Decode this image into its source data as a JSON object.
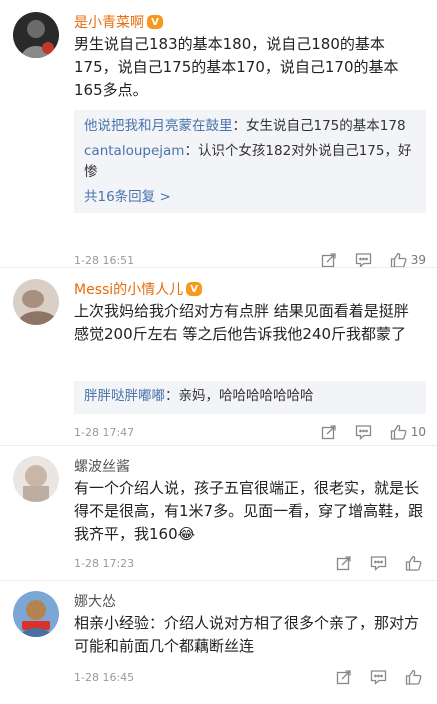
{
  "comments": [
    {
      "username": "是小青菜啊",
      "vip": "V",
      "text": "男生说自己183的基本180，说自己180的基本175，说自己175的基本170，说自己170的基本165多点。",
      "replies": [
        {
          "name": "他说把我和月亮蒙在鼓里",
          "sep": "：",
          "text": "女生说自己175的基本178"
        },
        {
          "name": "cantaloupejam",
          "sep": "：",
          "text": "认识个女孩182对外说自己175，好惨"
        }
      ],
      "more_replies": "共16条回复 >",
      "time": "1-28 16:51",
      "likes": "39"
    },
    {
      "username": "Messi的小情人儿",
      "vip": "V",
      "text": "上次我妈给我介绍对方有点胖 结果见面看着是挺胖 感觉200斤左右  等之后他告诉我他240斤我都蒙了",
      "replies": [
        {
          "name": "胖胖哒胖嘟嘟",
          "sep": "：",
          "text": "亲妈，哈哈哈哈哈哈哈"
        }
      ],
      "time": "1-28 17:47",
      "likes": "10"
    },
    {
      "username": "螺波丝酱",
      "text": "有一个介绍人说，孩子五官很端正，很老实，就是长得不是很高，有1米7多。见面一看，穿了增高鞋，跟我齐平，我160",
      "emoji": "😂",
      "time": "1-28 17:23",
      "likes": ""
    },
    {
      "username": "娜大怂",
      "text": "相亲小经验：介绍人说对方相了很多个亲了，那对方可能和前面几个都藕断丝连",
      "time": "1-28 16:45",
      "likes": ""
    }
  ],
  "colors": {
    "name_orange": "#e86b0a",
    "link_blue": "#4a74ad",
    "reply_bg": "#f3f4f7",
    "vip": "#f59a1d"
  },
  "icons": [
    "share-icon",
    "comment-icon",
    "like-icon"
  ]
}
